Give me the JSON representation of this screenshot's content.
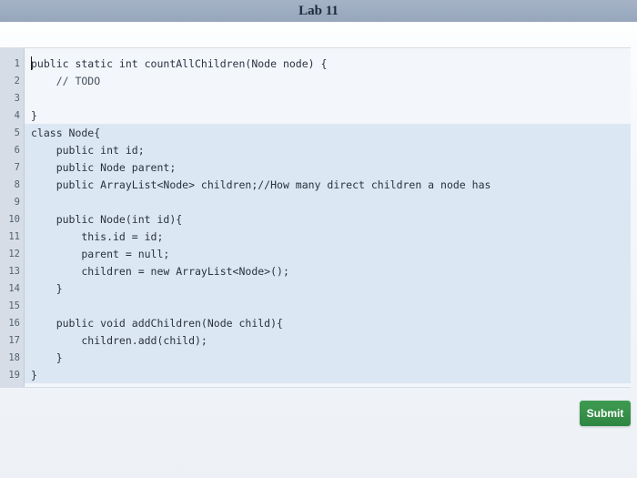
{
  "window": {
    "title": "Lab 11"
  },
  "editor": {
    "lines": [
      {
        "number": "1",
        "text": "public static int countAllChildren(Node node) {"
      },
      {
        "number": "2",
        "text": "    // TODO"
      },
      {
        "number": "3",
        "text": ""
      },
      {
        "number": "4",
        "text": "}"
      },
      {
        "number": "5",
        "text": "class Node{"
      },
      {
        "number": "6",
        "text": "    public int id;"
      },
      {
        "number": "7",
        "text": "    public Node parent;"
      },
      {
        "number": "8",
        "text": "    public ArrayList<Node> children;//How many direct children a node has"
      },
      {
        "number": "9",
        "text": ""
      },
      {
        "number": "10",
        "text": "    public Node(int id){"
      },
      {
        "number": "11",
        "text": "        this.id = id;"
      },
      {
        "number": "12",
        "text": "        parent = null;"
      },
      {
        "number": "13",
        "text": "        children = new ArrayList<Node>();"
      },
      {
        "number": "14",
        "text": "    }"
      },
      {
        "number": "15",
        "text": ""
      },
      {
        "number": "16",
        "text": "    public void addChildren(Node child){"
      },
      {
        "number": "17",
        "text": "        children.add(child);"
      },
      {
        "number": "18",
        "text": "    }"
      },
      {
        "number": "19",
        "text": "}"
      }
    ]
  },
  "actions": {
    "submit_label": "Submit"
  },
  "colors": {
    "submit_button": "#2f8542",
    "title_bar": "#9aa9be",
    "highlight_band": "#dbe7f3"
  },
  "icons": {
    "mouse_cursor": "cursor-icon"
  }
}
